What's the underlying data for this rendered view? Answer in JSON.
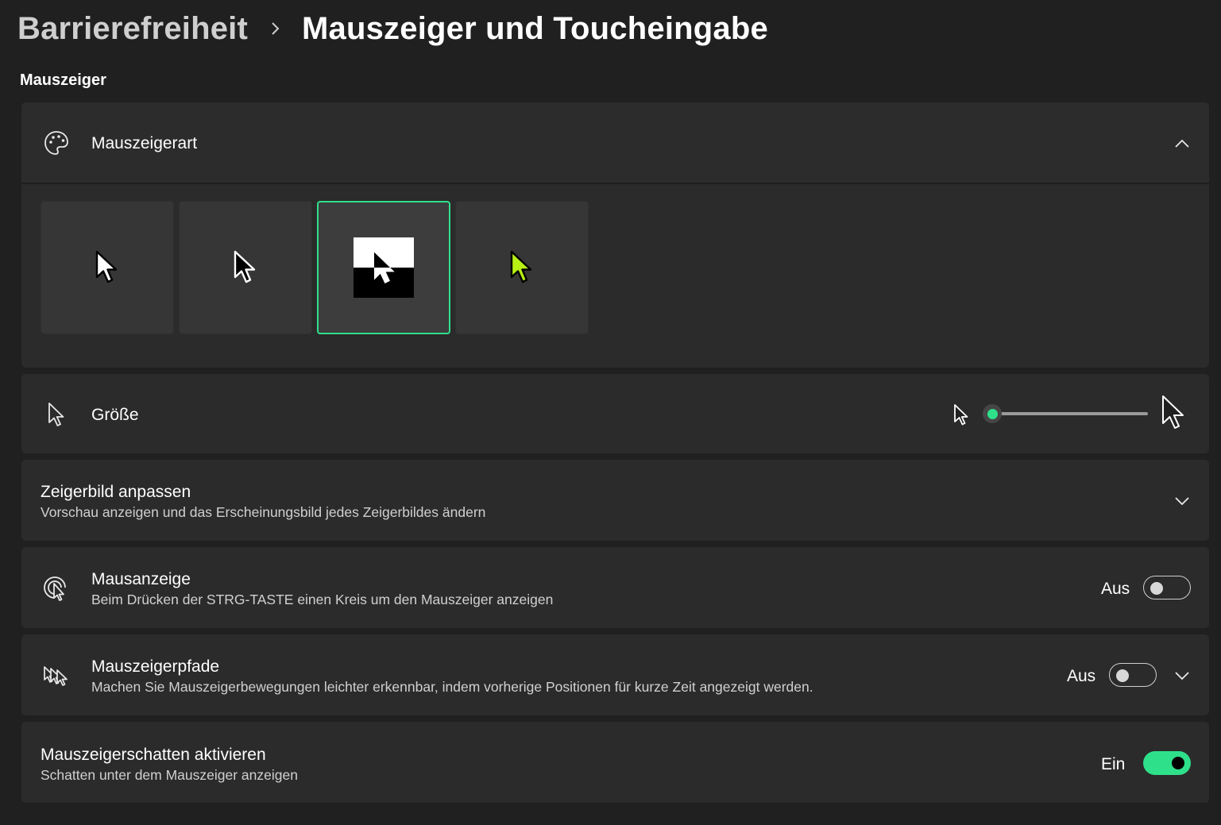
{
  "breadcrumb": {
    "parent": "Barrierefreiheit",
    "current": "Mauszeiger und Toucheingabe"
  },
  "section_title": "Mauszeiger",
  "pointer_style": {
    "title": "Mauszeigerart",
    "expanded": true,
    "options": [
      {
        "name": "white",
        "selected": false
      },
      {
        "name": "black",
        "selected": false
      },
      {
        "name": "inverted",
        "selected": true
      },
      {
        "name": "custom",
        "selected": false,
        "color": "#b8f014"
      }
    ]
  },
  "size": {
    "title": "Größe",
    "value": 1,
    "min": 1,
    "max": 15
  },
  "customize": {
    "title": "Zeigerbild anpassen",
    "subtitle": "Vorschau anzeigen und das Erscheinungsbild jedes Zeigerbildes ändern"
  },
  "indicator": {
    "title": "Mausanzeige",
    "subtitle": "Beim Drücken der STRG-TASTE einen Kreis um den Mauszeiger anzeigen",
    "state_label": "Aus",
    "on": false
  },
  "trails": {
    "title": "Mauszeigerpfade",
    "subtitle": "Machen Sie Mauszeigerbewegungen leichter erkennbar, indem vorherige Positionen für kurze Zeit angezeigt werden.",
    "state_label": "Aus",
    "on": false
  },
  "shadow": {
    "title": "Mauszeigerschatten aktivieren",
    "subtitle": "Schatten unter dem Mauszeiger anzeigen",
    "state_label": "Ein",
    "on": true
  },
  "colors": {
    "accent": "#2ee08a",
    "background": "#202020",
    "card": "#2b2b2b",
    "custom_pointer": "#b8f014"
  },
  "icons": {
    "pointer_style": "palette-icon",
    "size": "pointer-icon",
    "indicator": "pointer-indicator-icon",
    "trails": "pointer-trails-icon"
  }
}
